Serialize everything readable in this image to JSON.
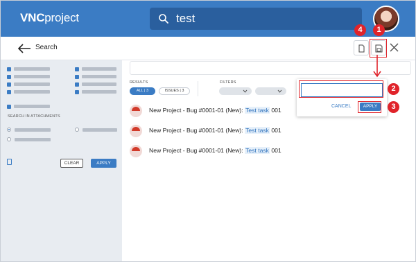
{
  "header": {
    "logo_bold": "VNC",
    "logo_rest": "project",
    "search_value": "test"
  },
  "toolbar": {
    "title": "Search"
  },
  "sidebar": {
    "search_in_attachments_label": "SEARCH IN ATTACHMENTS",
    "clear_label": "CLEAR",
    "apply_label": "APPLY"
  },
  "main": {
    "results_label": "RESULTS",
    "filters_label": "FILTERS",
    "tabs": [
      {
        "label": "ALL",
        "count": "3"
      },
      {
        "label": "ISSUES",
        "count": "3"
      }
    ],
    "results": [
      {
        "prefix": "New Project - Bug #0001-01 (New): ",
        "highlight": "Test task",
        "suffix": " 001"
      },
      {
        "prefix": "New Project - Bug #0001-01 (New): ",
        "highlight": "Test task",
        "suffix": " 001"
      },
      {
        "prefix": "New Project - Bug #0001-01 (New): ",
        "highlight": "Test task",
        "suffix": " 001"
      }
    ]
  },
  "popup": {
    "input_value": "",
    "cancel_label": "CANCEL",
    "apply_label": "APPLY"
  },
  "annotations": {
    "badges": [
      "1",
      "2",
      "3",
      "4"
    ],
    "color": "#e0232a"
  },
  "colors": {
    "brand": "#3b7cc4",
    "highlight": "#2f72bd",
    "sidebar_bg": "#e8ecf1"
  },
  "icons": [
    "search-icon",
    "back-arrow-icon",
    "document-icon",
    "save-icon",
    "close-icon",
    "trash-icon",
    "bug-icon"
  ]
}
